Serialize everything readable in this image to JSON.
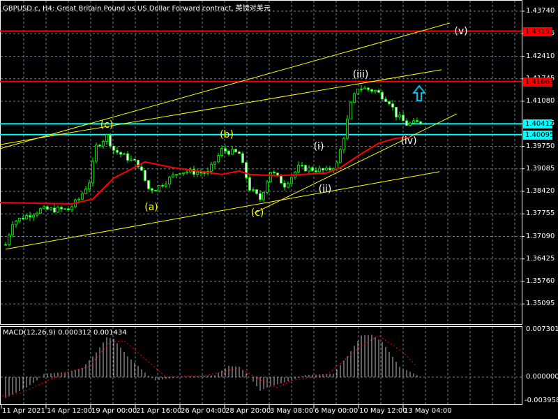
{
  "title": "GBPUSD.c, H4:  Great Britain Pound vs US Dollar Forward contract, 英镑对美元",
  "macd_title": "MACD(12,26,9) 0.000312 0.001434",
  "colors": {
    "candle": "#00ff00",
    "ma": "#ff0000",
    "trend": "#ffff00",
    "level_red": "#ff0000",
    "level_cyan": "#00ffff",
    "grid": "#6f7f8f",
    "macd_hist": "#c0c0c0",
    "macd_signal": "#ff0000"
  },
  "price_axis": [
    "1.43740",
    "1.43075",
    "1.42410",
    "1.41745",
    "1.41080",
    "1.40415",
    "1.39750",
    "1.39085",
    "1.38420",
    "1.37755",
    "1.37090",
    "1.36425",
    "1.35760",
    "1.35095"
  ],
  "levels": [
    {
      "price": 1.43152,
      "label": "1.43152",
      "color": "red"
    },
    {
      "price": 1.41663,
      "label": "1.41663",
      "color": "red"
    },
    {
      "price": 1.40412,
      "label": "1.40412",
      "color": "cyan"
    },
    {
      "price": 1.40095,
      "label": "1.40095",
      "color": "cyan"
    }
  ],
  "macd_axis": [
    "0.007301",
    "0.000000",
    "-0.003958"
  ],
  "time_axis": [
    "11 Apr 2021",
    "14 Apr 12:00",
    "19 Apr 00:00",
    "21 Apr 16:00",
    "26 Apr 04:00",
    "28 Apr 20:00",
    "3 May 08:00",
    "6 May 00:00",
    "10 May 12:00",
    "13 May 04:00"
  ],
  "waves": [
    {
      "text": "(v)",
      "color": "white"
    },
    {
      "text": "(iii)",
      "color": "white"
    },
    {
      "text": "(i)",
      "color": "white"
    },
    {
      "text": "(ii)",
      "color": "white"
    },
    {
      "text": "(iv)",
      "color": "white"
    },
    {
      "text": "(c)",
      "color": "yellow"
    },
    {
      "text": "(b)",
      "color": "yellow"
    },
    {
      "text": "(a)",
      "color": "yellow"
    },
    {
      "text": "(c)",
      "color": "yellow"
    }
  ],
  "chart_data": {
    "type": "candlestick",
    "symbol": "GBPUSD.c",
    "timeframe": "H4",
    "ylim": [
      1.346,
      1.4405
    ],
    "price_path": [
      [
        0,
        1.3685
      ],
      [
        2,
        1.3751
      ],
      [
        10,
        1.3788
      ],
      [
        18,
        1.3788
      ],
      [
        21,
        1.3819
      ],
      [
        24,
        1.3871
      ],
      [
        26,
        1.3974
      ],
      [
        29,
        1.4005
      ],
      [
        31,
        1.3964
      ],
      [
        38,
        1.3922
      ],
      [
        41,
        1.385
      ],
      [
        43,
        1.385
      ],
      [
        50,
        1.3902
      ],
      [
        58,
        1.3896
      ],
      [
        62,
        1.3964
      ],
      [
        67,
        1.3953
      ],
      [
        70,
        1.385
      ],
      [
        73,
        1.3819
      ],
      [
        76,
        1.3902
      ],
      [
        80,
        1.3861
      ],
      [
        84,
        1.3912
      ],
      [
        92,
        1.3902
      ],
      [
        95,
        1.3922
      ],
      [
        97,
        1.4005
      ],
      [
        99,
        1.4098
      ],
      [
        101,
        1.4149
      ],
      [
        106,
        1.4139
      ],
      [
        110,
        1.4108
      ],
      [
        112,
        1.4067
      ],
      [
        115,
        1.404
      ],
      [
        119,
        1.4046
      ]
    ],
    "ma": [
      [
        -2,
        1.3809
      ],
      [
        19,
        1.3805
      ],
      [
        25,
        1.3819
      ],
      [
        31,
        1.3881
      ],
      [
        40,
        1.3929
      ],
      [
        48,
        1.3912
      ],
      [
        62,
        1.3892
      ],
      [
        67,
        1.3902
      ],
      [
        70,
        1.3892
      ],
      [
        78,
        1.3888
      ],
      [
        92,
        1.3896
      ],
      [
        96,
        1.3912
      ],
      [
        102,
        1.3953
      ],
      [
        107,
        1.3984
      ],
      [
        112,
        1.3999
      ],
      [
        116,
        1.4001
      ]
    ],
    "trendlines": [
      [
        [
          -1.6,
          1.3968
        ],
        [
          127.4,
          1.4339
        ]
      ],
      [
        [
          -1.6,
          1.398
        ],
        [
          125,
          1.4201
        ]
      ],
      [
        [
          0,
          1.3671
        ],
        [
          124.4,
          1.39
        ]
      ],
      [
        [
          71.4,
          1.3778
        ],
        [
          129.4,
          1.4071
        ]
      ]
    ],
    "macd": {
      "ylim": [
        -0.003958,
        0.007301
      ],
      "hist": [
        [
          0,
          -0.0032
        ],
        [
          6,
          -0.0016
        ],
        [
          9,
          -0.0005
        ],
        [
          11,
          0.0005
        ],
        [
          18,
          0.0008
        ],
        [
          22,
          0.0014
        ],
        [
          26,
          0.0038
        ],
        [
          29,
          0.0061
        ],
        [
          31,
          0.0059
        ],
        [
          35,
          0.0032
        ],
        [
          41,
          0.0002
        ],
        [
          43,
          -0.0005
        ],
        [
          50,
          0
        ],
        [
          60,
          0.0003
        ],
        [
          64,
          0.0017
        ],
        [
          67,
          0.0016
        ],
        [
          70,
          0
        ],
        [
          73,
          -0.0021
        ],
        [
          75,
          -0.0016
        ],
        [
          82,
          -0.0005
        ],
        [
          86,
          0.0003
        ],
        [
          94,
          0.0005
        ],
        [
          98,
          0.0032
        ],
        [
          102,
          0.0064
        ],
        [
          105,
          0.0065
        ],
        [
          108,
          0.0054
        ],
        [
          113,
          0.0016
        ],
        [
          118,
          0.0003
        ]
      ],
      "signal": [
        [
          -1,
          -0.0029
        ],
        [
          5,
          -0.0024
        ],
        [
          12,
          -0.0005
        ],
        [
          18,
          0.0008
        ],
        [
          24,
          0.0016
        ],
        [
          30,
          0.0054
        ],
        [
          34,
          0.0056
        ],
        [
          46,
          0
        ],
        [
          58,
          0.0003
        ],
        [
          67,
          0.0014
        ],
        [
          76,
          -0.0013
        ],
        [
          78,
          -0.0016
        ],
        [
          82,
          -0.0005
        ],
        [
          92,
          0.0003
        ],
        [
          102,
          0.0048
        ],
        [
          107,
          0.0064
        ],
        [
          114,
          0.0038
        ],
        [
          118,
          0.0016
        ]
      ]
    }
  }
}
